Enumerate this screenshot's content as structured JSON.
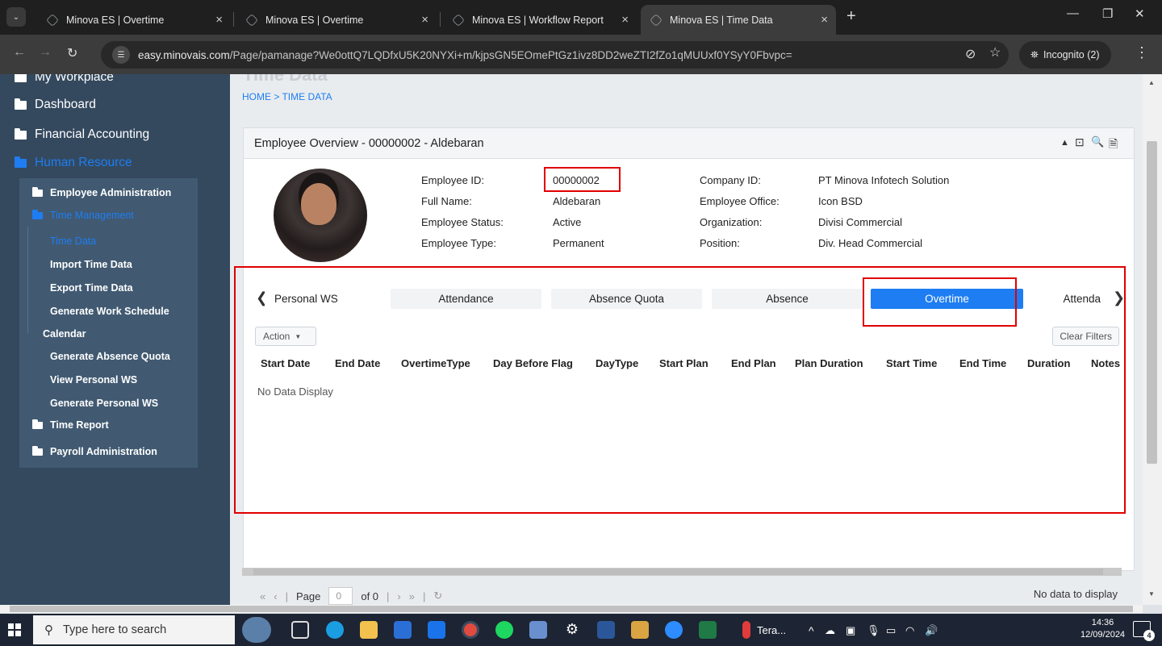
{
  "browser": {
    "tabs": [
      {
        "title": "Minova ES | Overtime",
        "active": false
      },
      {
        "title": "Minova ES | Overtime",
        "active": false
      },
      {
        "title": "Minova ES | Workflow Report",
        "active": false
      },
      {
        "title": "Minova ES | Time Data",
        "active": true
      }
    ],
    "tab_close": "×",
    "new_tab": "+",
    "url_host": "easy.minovais.com",
    "url_path": "/Page/pamanage?We0ottQ7LQDfxU5K20NYXi+m/kjpsGN5EOmePtGz1ivz8DD2weZTI2fZo1qMUUxf0YSyY0Fbvpc=",
    "incognito_label": "Incognito (2)"
  },
  "sidebar": {
    "top_cut": "My Workplace",
    "items": [
      {
        "label": "Dashboard"
      },
      {
        "label": "Financial Accounting"
      },
      {
        "label": "Human Resource"
      }
    ],
    "hr_sub": {
      "employee_admin": "Employee Administration",
      "time_management": "Time Management",
      "time_leaves": [
        "Time Data",
        "Import Time Data",
        "Export Time Data",
        "Generate Work Schedule"
      ],
      "calendar": "Calendar",
      "calendar_leaves": [
        "Generate Absence Quota",
        "View Personal WS",
        "Generate Personal WS"
      ],
      "time_report": "Time Report",
      "payroll": "Payroll Administration"
    }
  },
  "page": {
    "title_cut": "Time Data",
    "breadcrumb": "HOME > TIME DATA"
  },
  "panel": {
    "title": "Employee Overview - 00000002 - Aldebaran",
    "tools": [
      "▲",
      "⊡",
      "🔍",
      "🗎"
    ],
    "left_info": [
      {
        "label": "Employee ID:",
        "value": "00000002"
      },
      {
        "label": "Full Name:",
        "value": "Aldebaran"
      },
      {
        "label": "Employee Status:",
        "value": "Active"
      },
      {
        "label": "Employee Type:",
        "value": "Permanent"
      }
    ],
    "right_info": [
      {
        "label": "Company ID:",
        "value": "PT Minova Infotech Solution"
      },
      {
        "label": "Employee Office:",
        "value": "Icon BSD"
      },
      {
        "label": "Organization:",
        "value": "Divisi Commercial"
      },
      {
        "label": "Position:",
        "value": "Div. Head Commercial"
      }
    ],
    "tabs": [
      "Personal WS",
      "Attendance",
      "Absence Quota",
      "Absence",
      "Overtime",
      "Attenda"
    ],
    "active_tab": "Overtime"
  },
  "grid": {
    "action_label": "Action",
    "clear_filters": "Clear Filters",
    "columns": [
      "Start Date",
      "End Date",
      "OvertimeType",
      "Day Before Flag",
      "DayType",
      "Start Plan",
      "End Plan",
      "Plan Duration",
      "Start Time",
      "End Time",
      "Duration",
      "Notes"
    ],
    "empty_text": "No Data Display",
    "pager_label": "Page",
    "page_value": "0",
    "of_label": "of 0",
    "no_data_to_display": "No data to display"
  },
  "taskbar": {
    "search_placeholder": "Type here to search",
    "weather": "Tera...",
    "time": "14:36",
    "date": "12/09/2024",
    "notifications": "4"
  },
  "colors": {
    "accent": "#1e7df2",
    "sidebar_bg": "#34495e",
    "highlight": "#e00000"
  }
}
